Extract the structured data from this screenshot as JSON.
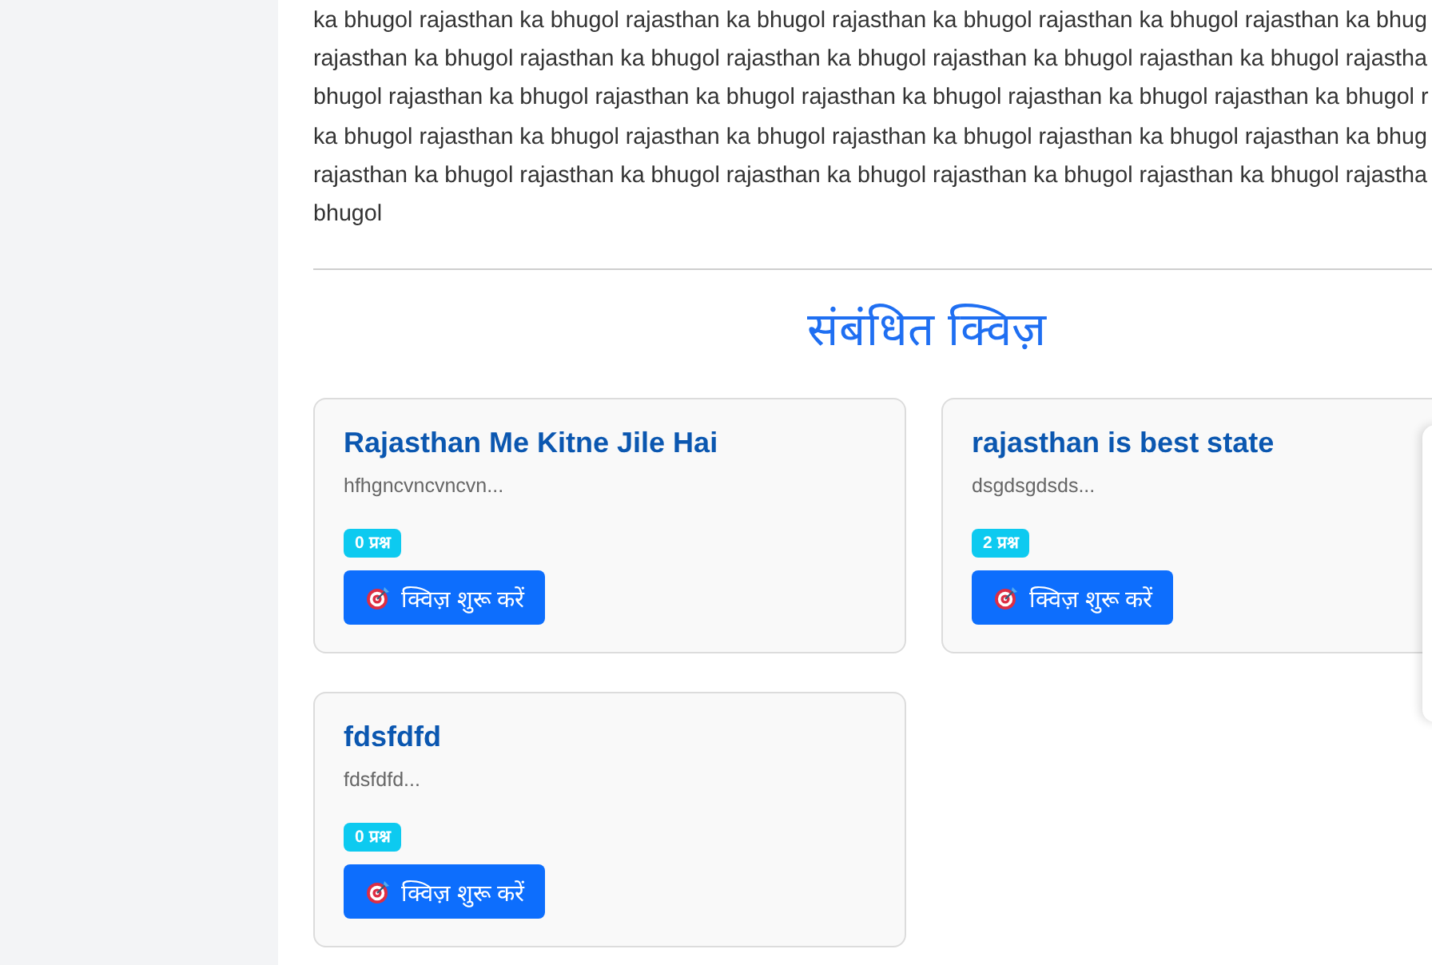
{
  "article": {
    "lines": [
      "ka bhugol rajasthan ka bhugol rajasthan ka bhugol rajasthan ka bhugol rajasthan ka bhugol rajasthan ka bhug",
      "rajasthan ka bhugol rajasthan ka bhugol rajasthan ka bhugol rajasthan ka bhugol rajasthan ka bhugol rajastha",
      "bhugol rajasthan ka bhugol rajasthan ka bhugol rajasthan ka bhugol rajasthan ka bhugol rajasthan ka bhugol r",
      "ka bhugol rajasthan ka bhugol rajasthan ka bhugol rajasthan ka bhugol rajasthan ka bhugol rajasthan ka bhug",
      "rajasthan ka bhugol rajasthan ka bhugol rajasthan ka bhugol rajasthan ka bhugol rajasthan ka bhugol rajastha",
      "bhugol"
    ]
  },
  "related_quizzes": {
    "heading": "संबंधित क्विज़",
    "cards": [
      {
        "title": "Rajasthan Me Kitne Jile Hai",
        "description": "hfhgncvncvncvn...",
        "question_count": "0 प्रश्न",
        "button_label": "क्विज़ शुरू करें"
      },
      {
        "title": "rajasthan is best state",
        "description": "dsgdsgdsds...",
        "question_count": "2 प्रश्न",
        "button_label": "क्विज़ शुरू करें"
      },
      {
        "title": "fdsfdfd",
        "description": "fdsfdfd...",
        "question_count": "0 प्रश्न",
        "button_label": "क्विज़ शुरू करें"
      }
    ]
  }
}
